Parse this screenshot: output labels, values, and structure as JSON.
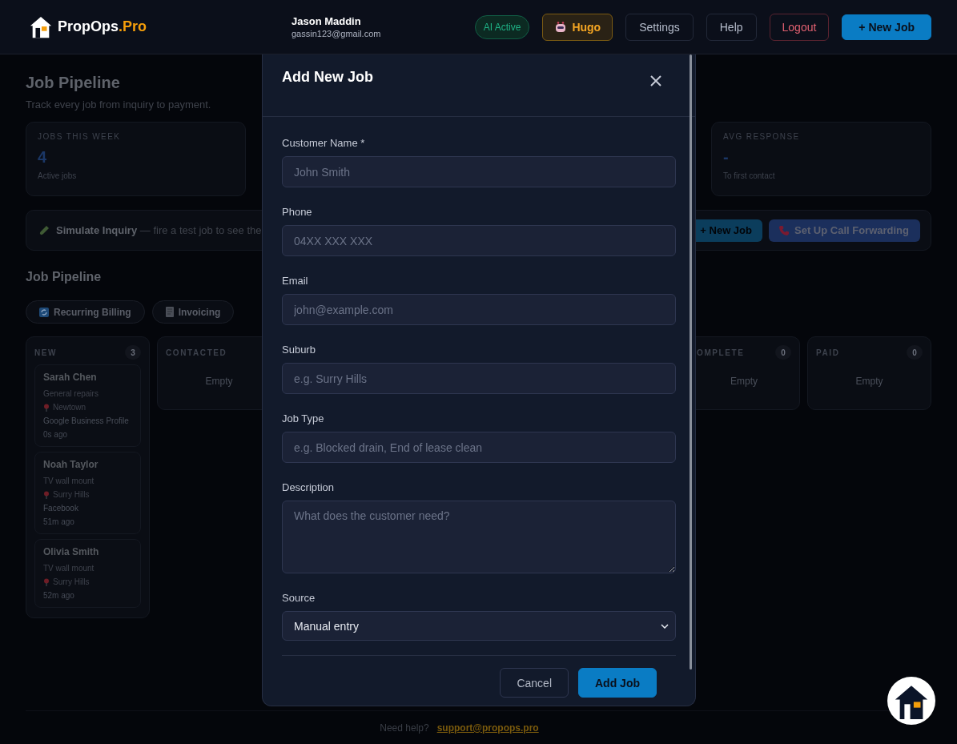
{
  "header": {
    "brand": "PropOps",
    "brand_suffix": ".Pro",
    "user_name": "Jason Maddin",
    "user_email": "gassin123@gmail.com",
    "buttons": [
      {
        "kind": "status",
        "label": "AI Active"
      },
      {
        "kind": "assistant",
        "label": "Hugo"
      },
      {
        "kind": "plain",
        "label": "Settings"
      },
      {
        "kind": "plain",
        "label": "Help"
      },
      {
        "kind": "danger",
        "label": "Logout"
      },
      {
        "kind": "primary",
        "label": "+ New Job"
      }
    ]
  },
  "page": {
    "title": "Job Pipeline",
    "subtitle": "Track every job from inquiry to payment.",
    "stats": [
      {
        "label": "JOBS THIS WEEK",
        "value": "4",
        "note": "Active jobs"
      },
      {
        "label": "AVG RESPONSE",
        "value": "-",
        "note": "To first contact"
      }
    ],
    "simulate": {
      "title": "Simulate Inquiry",
      "text": "— fire a test job to see the",
      "buttons": [
        {
          "kind": "primary",
          "label": "+ New Job"
        },
        {
          "kind": "call",
          "label": "Set Up Call Forwarding"
        }
      ]
    },
    "section_title": "Job Pipeline",
    "chips": [
      {
        "kind": "recurring",
        "label": "Recurring Billing"
      },
      {
        "kind": "invoice",
        "label": "Invoicing"
      }
    ],
    "columns": [
      {
        "title": "NEW",
        "count": "3",
        "jobs": [
          {
            "name": "Sarah Chen",
            "type": "General repairs",
            "suburb": "Newtown",
            "source": "Google Business Profile",
            "time": "0s ago"
          },
          {
            "name": "Noah Taylor",
            "type": "TV wall mount",
            "suburb": "Surry Hills",
            "source": "Facebook",
            "time": "51m ago"
          },
          {
            "name": "Olivia Smith",
            "type": "TV wall mount",
            "suburb": "Surry Hills",
            "time": "52m ago"
          }
        ]
      },
      {
        "title": "CONTACTED",
        "empty": "Empty"
      },
      {
        "title": "OMPLETE",
        "count": "0",
        "empty": "Empty"
      },
      {
        "title": "PAID",
        "count": "0",
        "empty": "Empty"
      }
    ]
  },
  "modal": {
    "title": "Add New Job",
    "fields": [
      {
        "kind": "input",
        "label": "Customer Name *",
        "placeholder": "John Smith"
      },
      {
        "kind": "input",
        "label": "Phone",
        "placeholder": "04XX XXX XXX"
      },
      {
        "kind": "input",
        "label": "Email",
        "placeholder": "john@example.com"
      },
      {
        "kind": "input",
        "label": "Suburb",
        "placeholder": "e.g. Surry Hills"
      },
      {
        "kind": "input",
        "label": "Job Type",
        "placeholder": "e.g. Blocked drain, End of lease clean"
      },
      {
        "kind": "textarea",
        "label": "Description",
        "placeholder": "What does the customer need?"
      },
      {
        "kind": "select",
        "label": "Source",
        "value": "Manual entry"
      }
    ],
    "buttons": [
      {
        "kind": "secondary",
        "label": "Cancel"
      },
      {
        "kind": "primary",
        "label": "Add Job"
      }
    ]
  },
  "footer": {
    "text": "Need help?",
    "link": "support@propops.pro"
  }
}
